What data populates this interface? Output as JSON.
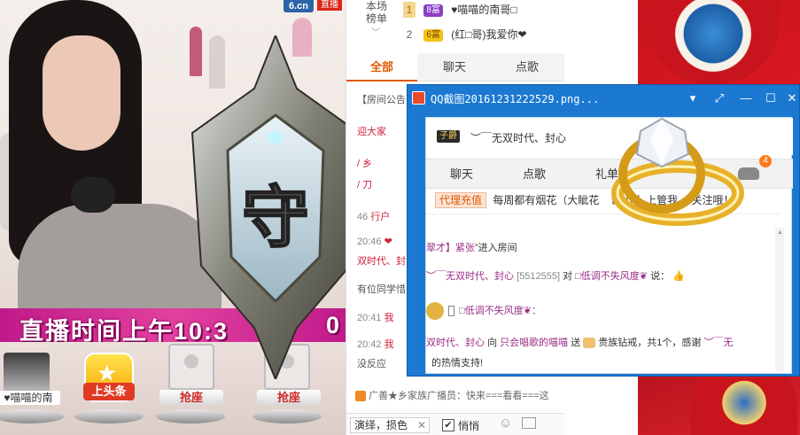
{
  "video": {
    "site_logo": "6.cn",
    "live_tag": "直播",
    "banner_text": "直播时间上午10:3",
    "banner_trailing": "0",
    "emblem_char": "守",
    "slots": [
      {
        "label": "♥喵喵的南"
      },
      {
        "label": "上头条"
      },
      {
        "label": "抢座"
      },
      {
        "label": "抢座"
      }
    ]
  },
  "chat_panel": {
    "ranking_title": "本场\n榜单",
    "ranking": [
      {
        "rank": "1",
        "level": "8富",
        "name": "♥喵喵的南哥□"
      },
      {
        "rank": "2",
        "level": "6富",
        "name": "(红□哥)我爱你❤"
      }
    ],
    "tabs": [
      "全部",
      "聊天",
      "点歌"
    ],
    "messages": [
      {
        "time": "",
        "text": "【房间公告】"
      },
      {
        "time": "",
        "text": "迎大家"
      },
      {
        "time": "",
        "text": "/ 乡"
      },
      {
        "time": "",
        "text": "/ 刀"
      },
      {
        "time": "46",
        "text": "行户"
      },
      {
        "time": "20:46",
        "text": "❤"
      },
      {
        "time": "",
        "text": "双时代、封"
      },
      {
        "time": "",
        "text": "有位同学惜"
      },
      {
        "time": "20:41",
        "text": "我"
      },
      {
        "time": "20:42",
        "text": "我"
      },
      {
        "time": "",
        "text": "没反应"
      }
    ],
    "announce": "广善★乡家族广播员：快来===看看===这",
    "input_chip": "演绎，损色",
    "checkbox_label": "悄悄"
  },
  "qq_window": {
    "title": "QQ截图20161231222529.png...",
    "controls": [
      "▾",
      "⤢",
      "—",
      "☐",
      "✕"
    ],
    "inner": {
      "user_badge": "子爵",
      "username": "︶￣无双时代、封心",
      "tabs": [
        "聊天",
        "点歌",
        "礼单"
      ],
      "car_count": "4",
      "agent_button": "代理充值",
      "ad_text": "每周都有烟花（大眦花",
      "ad_tail": "关注哦！",
      "ad_mid": "击小礼",
      "ad_mid2": "上管我",
      "messages": [
        {
          "parts": [
            "翠才】紧张",
            "”进入房间"
          ]
        },
        {
          "parts": [
            "︶￣无双时代、封心",
            "[5512555]",
            "对",
            "□低调不失风度❦",
            "说："
          ]
        },
        {
          "parts": [
            "□低调不失风度❦："
          ]
        },
        {
          "parts": [
            "双时代、封心",
            "向",
            "只会唱歌的喵喵",
            "送",
            "贵族钻戒，共1个，感谢",
            "︶￣无"
          ]
        },
        {
          "parts": [
            "的热情支持!"
          ]
        }
      ]
    }
  },
  "colors": {
    "accent": "#e05a00",
    "qq_blue": "#1b79d2",
    "banner_pink": "#e2419f",
    "bg_red": "#d7222b"
  }
}
